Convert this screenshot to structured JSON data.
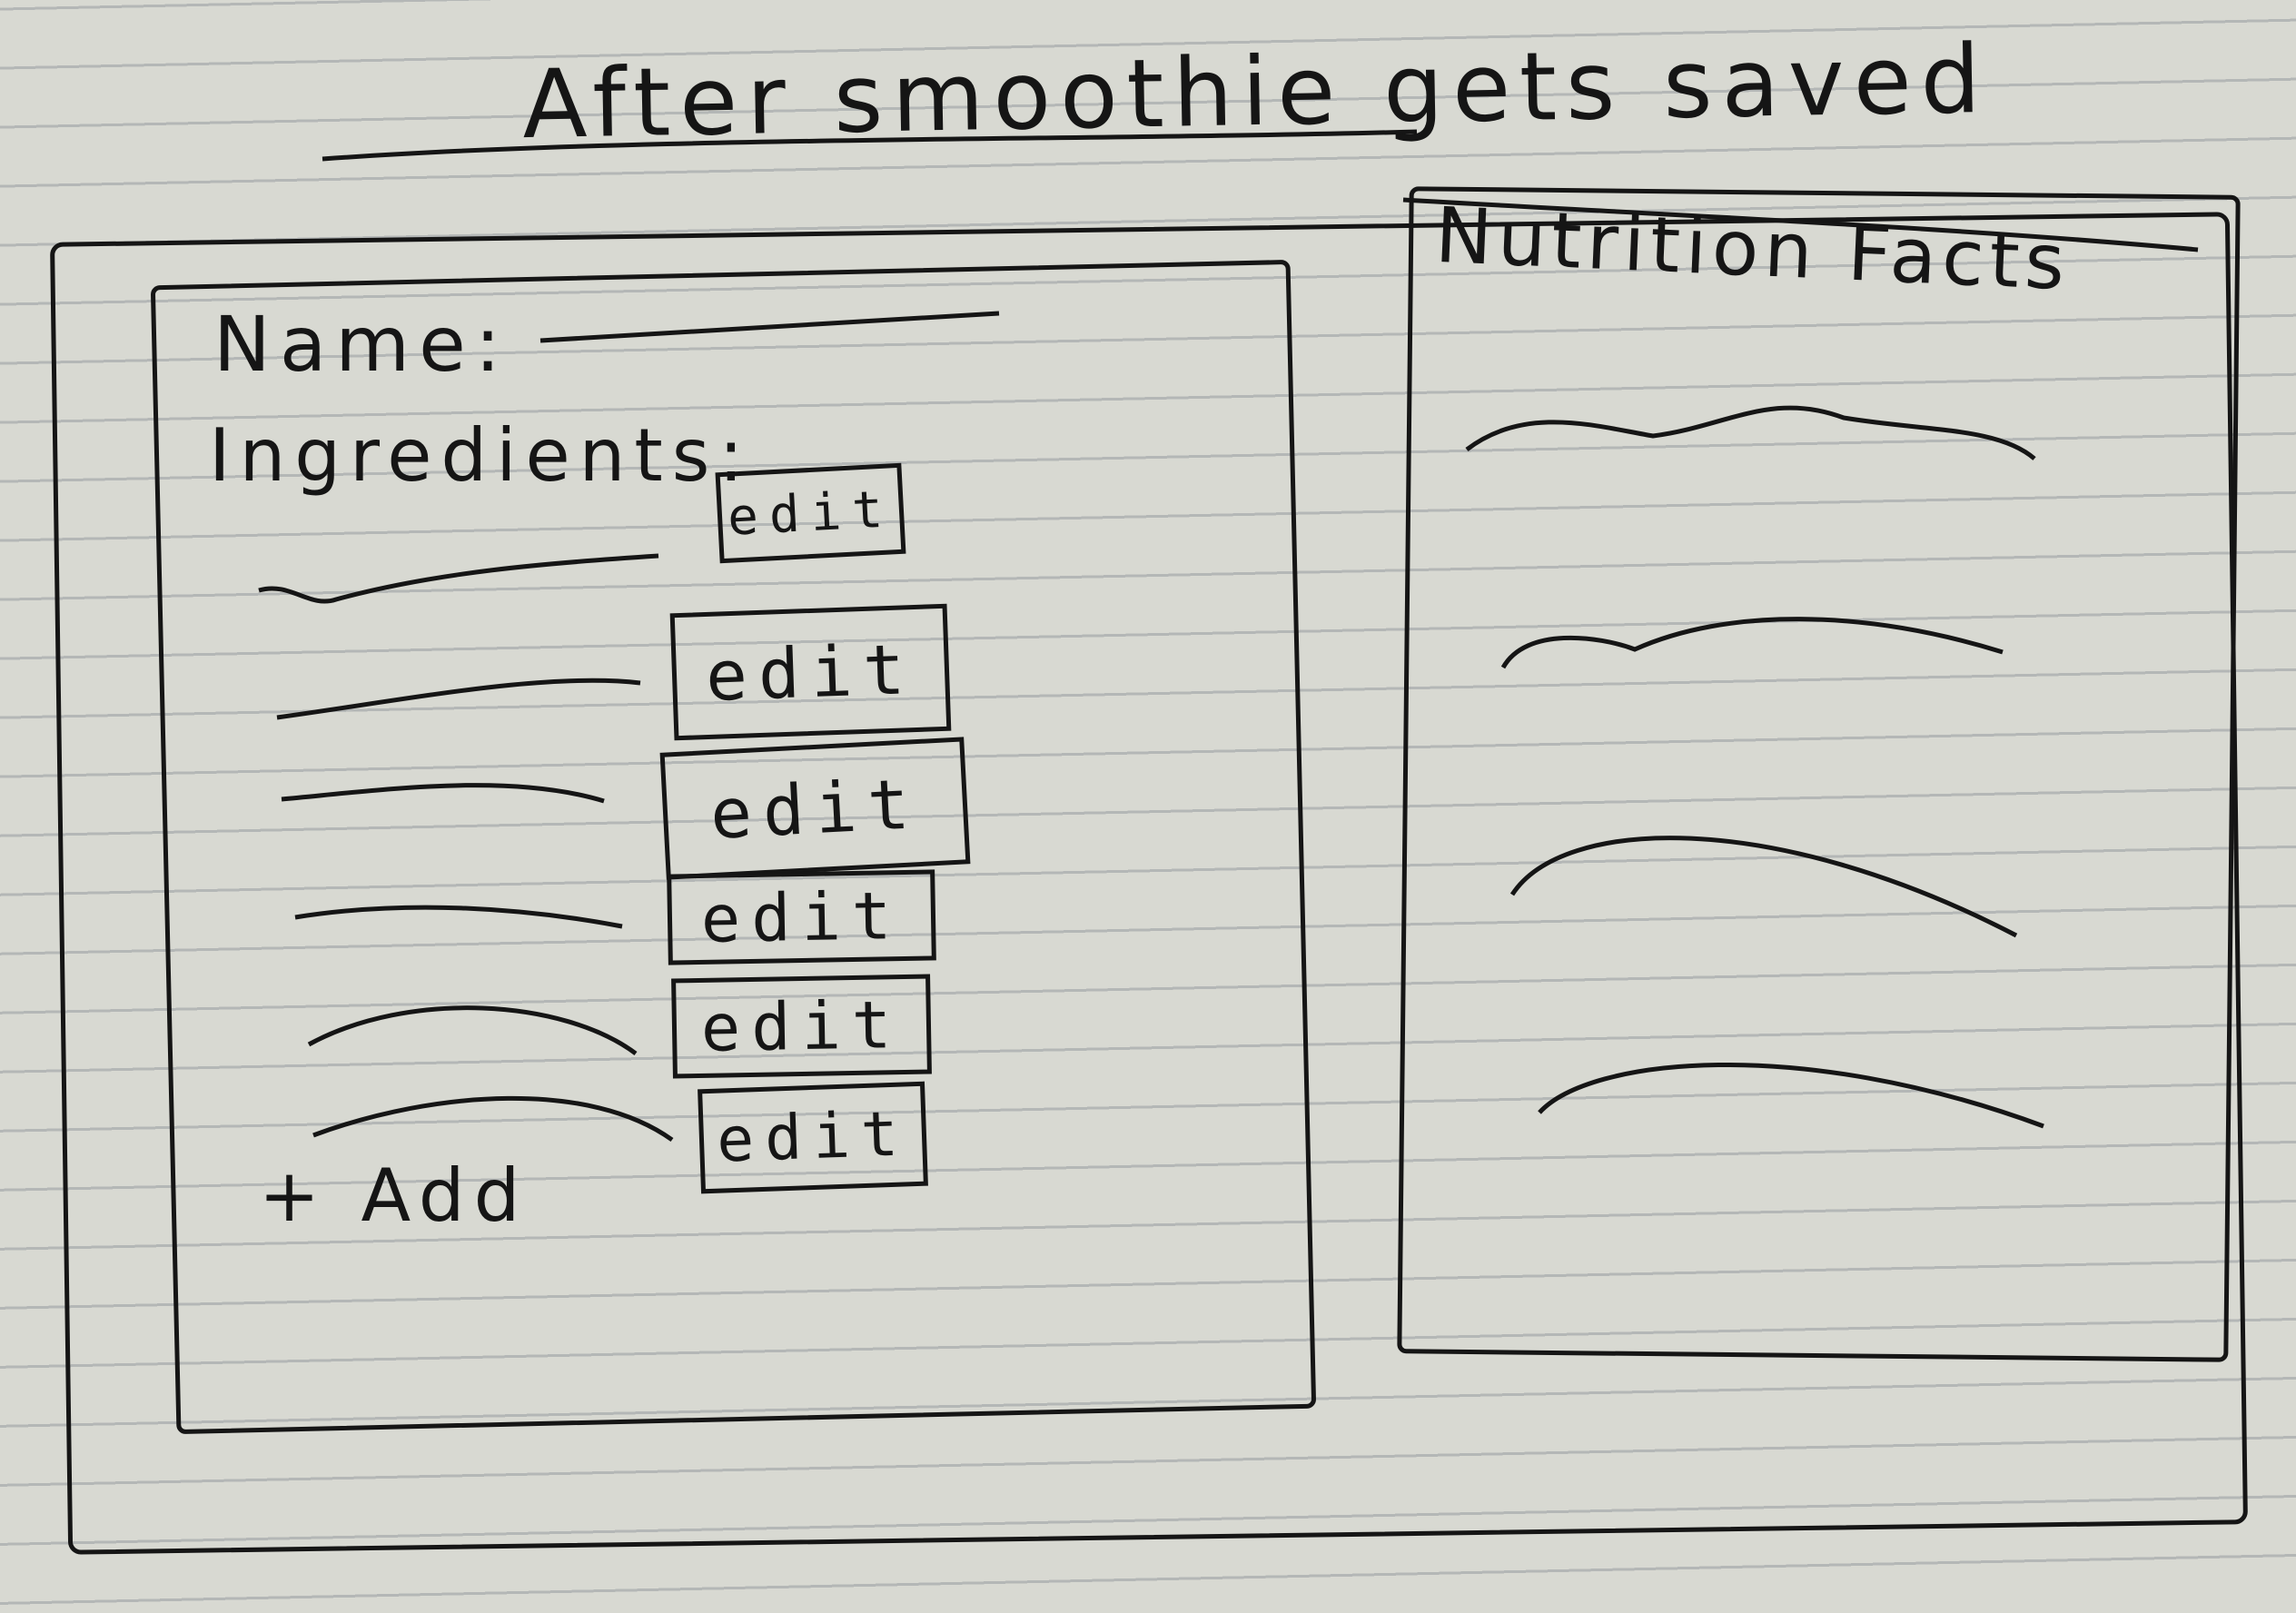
{
  "page": {
    "title": "After smoothie gets saved"
  },
  "form": {
    "name_label": "Name:",
    "ingredients_label": "Ingredients:",
    "edit_label": "edit",
    "edit_buttons": [
      "edit",
      "edit",
      "edit",
      "edit",
      "edit",
      "edit"
    ],
    "add_label": "+ Add"
  },
  "nutrition": {
    "title": "Nutrition Facts"
  },
  "colors": {
    "paper": "#d8d9d2",
    "ink": "#151515",
    "rule_lines": "#b9bcb8"
  }
}
